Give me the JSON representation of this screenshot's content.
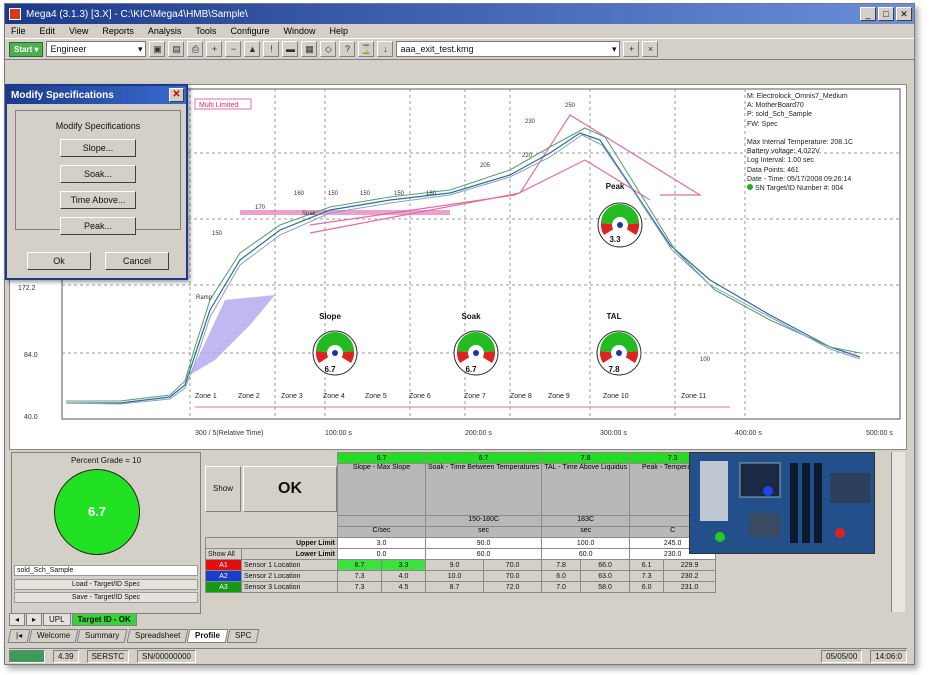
{
  "window": {
    "title": "Mega4 (3.1.3) [3.X] - C:\\KIC\\Mega4\\HMB\\Sample\\",
    "min": "_",
    "max": "□",
    "close": "✕"
  },
  "menu": [
    "File",
    "Edit",
    "View",
    "Reports",
    "Analysis",
    "Tools",
    "Configure",
    "Window",
    "Help"
  ],
  "toolbar": {
    "mode": "Engineer",
    "file": "aaa_exit_test.kmg",
    "tool_icons": [
      "save",
      "open",
      "print",
      "zoom-in",
      "zoom-out",
      "lock",
      "warning",
      "flag",
      "grid",
      "measure",
      "help"
    ]
  },
  "chart": {
    "badge": "Multi Limited",
    "legend": [
      "M: Electrolock_Omnis7_Medium",
      "A: MotherBoard70",
      "P: sold_Sch_Sample",
      "FW: Spec",
      "",
      "Max Internal Temperature: 208.1C",
      "Battery voltage: 4.022V",
      "Log Interval: 1.00 sec",
      "Data Points: 461",
      "Date - Time: 05/17/2008 09:26:14",
      "SN Target/ID Number #: 004"
    ],
    "ylabels": [
      "172.2",
      "84.0",
      "40.0"
    ],
    "xlabels": [
      "300 / 5(Relative Time)",
      "100:00 s",
      "200:00 s",
      "300:00 s",
      "400:00 s",
      "500:00 s"
    ],
    "zones": [
      "Zone 1",
      "Zone 2",
      "Zone 3",
      "Zone 4",
      "Zone 5",
      "Zone 6",
      "Zone 7",
      "Zone 8",
      "Zone 9",
      "Zone 10",
      "Zone 11"
    ],
    "annotations": [
      "250",
      "230",
      "220",
      "205",
      "180",
      "160",
      "150",
      "150",
      "150",
      "170",
      "150",
      "100",
      "Ramp",
      "Soak"
    ],
    "gauges": [
      {
        "title": "Peak",
        "value": "3.3"
      },
      {
        "title": "Slope",
        "value": "6.7"
      },
      {
        "title": "Soak",
        "value": "6.7"
      },
      {
        "title": "TAL",
        "value": "7.8"
      }
    ]
  },
  "dialog": {
    "title": "Modify Specifications",
    "group_label": "Modify Specifications",
    "buttons": [
      "Slope...",
      "Soak...",
      "Time Above...",
      "Peak..."
    ],
    "ok": "Ok",
    "cancel": "Cancel"
  },
  "process": {
    "title": "Percent Grade = 10",
    "value": "6.7",
    "profile": "sold_Sch_Sample",
    "load": "Load - Target/ID Spec",
    "save": "Save - Target/ID Spec"
  },
  "spec": {
    "show_label": "Show",
    "ok_label": "OK",
    "show_all": "Show All",
    "header_vals": [
      "6.7",
      "6.7",
      "7.8",
      "7.3"
    ],
    "header_names": [
      "Slope - Max Slope",
      "Soak - Time Between Temperatures",
      "TAL - Time Above Liquidus",
      "Peak - Temperature"
    ],
    "sub_vals": [
      "",
      "150-180C",
      "183C",
      ""
    ],
    "units": [
      "C/sec",
      "sec",
      "sec",
      "C"
    ],
    "upper_label": "Upper Limit",
    "lower_label": "Lower Limit",
    "upper": [
      "3.0",
      "90.0",
      "100.0",
      "245.0"
    ],
    "lower": [
      "0.0",
      "60.0",
      "60.0",
      "230.0"
    ],
    "sensors": [
      {
        "tag": "A1",
        "name": "Sensor 1 Location",
        "c1": "6.7",
        "c1b": "3.3",
        "c2": "9.0",
        "c2b": "70.0",
        "c3": "7.8",
        "c3b": "66.0",
        "c4": "6.1",
        "c4b": "229.9"
      },
      {
        "tag": "A2",
        "name": "Sensor 2 Location",
        "c1": "7.3",
        "c1b": "4.0",
        "c2": "10.0",
        "c2b": "70.0",
        "c3": "6.0",
        "c3b": "63.0",
        "c4": "7.3",
        "c4b": "230.2"
      },
      {
        "tag": "A3",
        "name": "Sensor 3 Location",
        "c1": "7.3",
        "c1b": "4.5",
        "c2": "8.7",
        "c2b": "72.0",
        "c3": "7.0",
        "c3b": "58.0",
        "c4": "6.0",
        "c4b": "231.0"
      }
    ]
  },
  "tabs1": [
    "UPL",
    "Target ID - OK"
  ],
  "tabs2": [
    "Welcome",
    "Summary",
    "Spreadsheet",
    "Profile",
    "SPC"
  ],
  "status": {
    "left_value": "4.39",
    "port": "SERSTC",
    "serial": "SN/00000000",
    "date": "05/05/00",
    "time": "14:06:0"
  }
}
